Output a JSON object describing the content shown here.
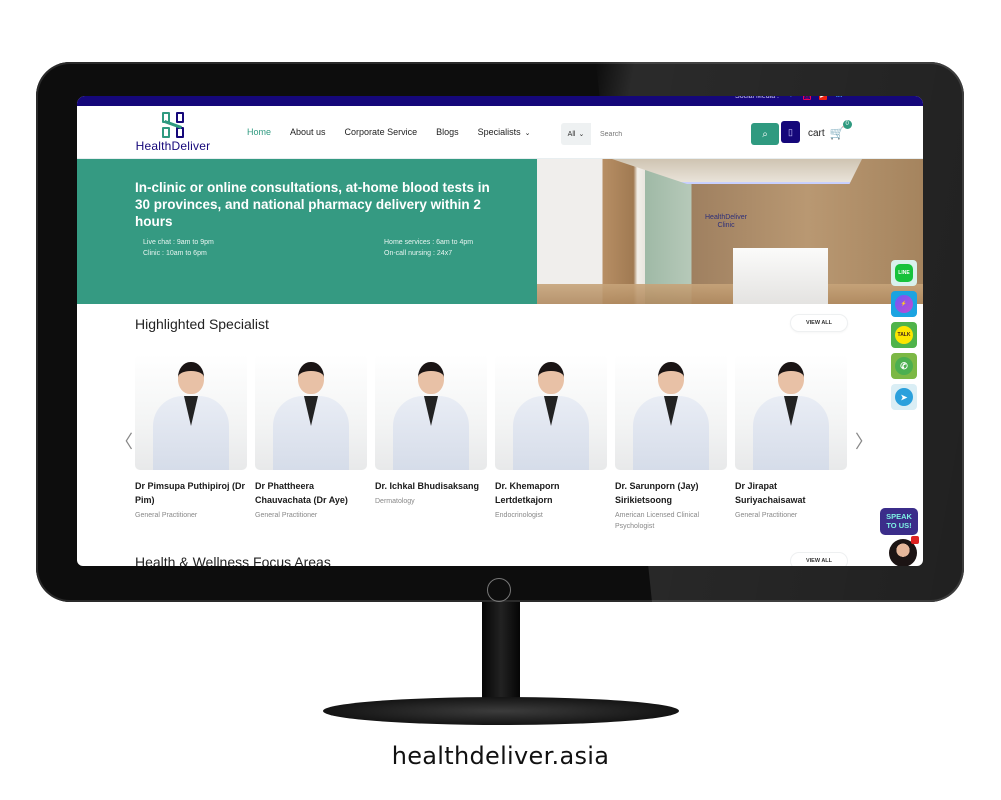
{
  "caption": "healthdeliver.asia",
  "topbar": {
    "social_label": "Social Media :",
    "social_icons": [
      "facebook-icon",
      "instagram-icon",
      "youtube-icon",
      "linkedin-icon"
    ]
  },
  "brand": {
    "name": "HealthDeliver"
  },
  "nav": {
    "items": [
      {
        "label": "Home",
        "active": true
      },
      {
        "label": "About us"
      },
      {
        "label": "Corporate Service"
      },
      {
        "label": "Blogs"
      },
      {
        "label": "Specialists",
        "has_dropdown": true
      }
    ]
  },
  "search": {
    "category": "All",
    "placeholder": "Search",
    "value": ""
  },
  "cart": {
    "label": "cart",
    "count": "0"
  },
  "hero": {
    "title": "In-clinic or online consultations, at-home blood tests in 30 provinces, and national pharmacy delivery within 2 hours",
    "hours_left": [
      "Live chat : 9am to 9pm",
      "Clinic : 10am to 6pm"
    ],
    "hours_right": [
      "Home services : 6am to 4pm",
      "On-call nursing : 24x7"
    ],
    "image_sign": [
      "HealthDeliver",
      "Clinic"
    ]
  },
  "specialists": {
    "title": "Highlighted Specialist",
    "view_all": "VIEW ALL",
    "doctors": [
      {
        "name": "Dr Pimsupa Puthipiroj (Dr Pim)",
        "specialty": "General Practitioner"
      },
      {
        "name": "Dr Phattheera Chauvachata (Dr Aye)",
        "specialty": "General Practitioner"
      },
      {
        "name": "Dr. Ichkal Bhudisaksang",
        "specialty": "Dermatology"
      },
      {
        "name": "Dr. Khemaporn Lertdetkajorn",
        "specialty": "Endocrinologist"
      },
      {
        "name": "Dr. Sarunporn (Jay) Sirikietsoong",
        "specialty": "American Licensed Clinical Psychologist"
      },
      {
        "name": "Dr Jirapat Suriyachaisawat",
        "specialty": "General Practitioner"
      }
    ]
  },
  "focus_areas": {
    "title": "Health & Wellness Focus Areas",
    "view_all": "VIEW ALL"
  },
  "chat_widgets": [
    {
      "name": "LINE",
      "glyph": "LINE"
    },
    {
      "name": "Messenger",
      "glyph": "⚡"
    },
    {
      "name": "KakaoTalk",
      "glyph": "TALK"
    },
    {
      "name": "WhatsApp",
      "glyph": "✆"
    },
    {
      "name": "Telegram",
      "glyph": "➤"
    }
  ],
  "speak_widget": {
    "label": "SPEAK TO US!"
  },
  "colors": {
    "brand_green": "#359a82",
    "brand_navy": "#15077a"
  }
}
